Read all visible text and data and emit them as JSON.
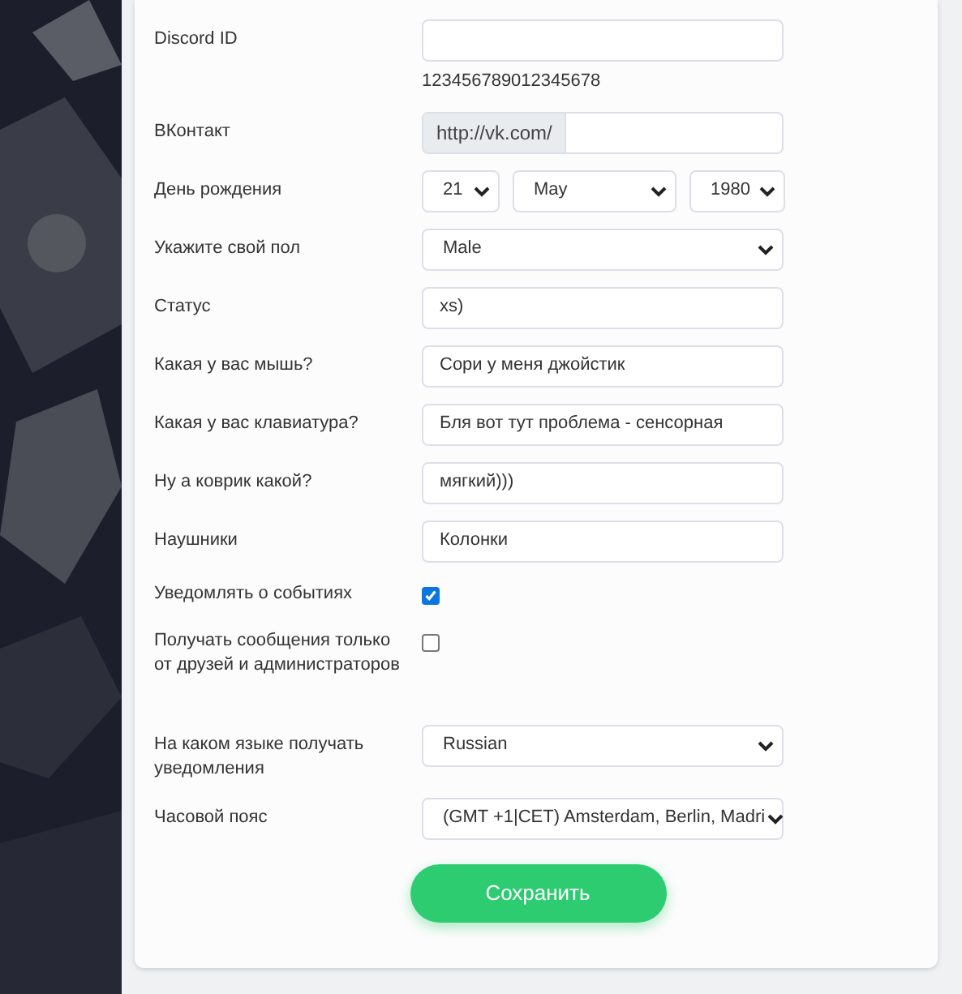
{
  "rows": [
    {
      "kind": "text",
      "label": "Discord ID",
      "value": "",
      "hint": "123456789012345678"
    },
    {
      "kind": "prefix",
      "label": "ВКонтакт",
      "prefix": "http://vk.com/",
      "value": ""
    },
    {
      "kind": "date",
      "label": "День рождения",
      "day": "21",
      "month": "May",
      "year": "1980"
    },
    {
      "kind": "select",
      "label": "Укажите свой пол",
      "value": "Male"
    },
    {
      "kind": "text",
      "label": "Статус",
      "value": "xs)"
    },
    {
      "kind": "text",
      "label": "Какая у вас мышь?",
      "value": "Сори у меня джойстик"
    },
    {
      "kind": "text",
      "label": "Какая у вас клавиатура?",
      "value": "Бля вот тут проблема - сенсорная"
    },
    {
      "kind": "text",
      "label": "Ну а коврик какой?",
      "value": "мягкий)))"
    },
    {
      "kind": "text",
      "label": "Наушники",
      "value": "Колонки"
    },
    {
      "kind": "checkbox",
      "label": "Уведомлять о событиях",
      "checked": true
    },
    {
      "kind": "checkbox",
      "label": "Получать сообщения только от друзей и администраторов",
      "checked": false
    },
    {
      "kind": "select",
      "label": "На каком языке получать уведомления",
      "value": "Russian"
    },
    {
      "kind": "select",
      "label": "Часовой пояс",
      "value": "(GMT +1|CET) Amsterdam, Berlin, Madri"
    }
  ],
  "save_button": "Сохранить"
}
